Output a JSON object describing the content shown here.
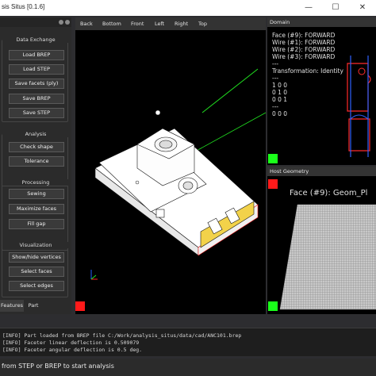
{
  "window": {
    "title": "sis Situs [0.1.6]",
    "minimize_glyph": "—",
    "maximize_glyph": "☐",
    "close_glyph": "✕"
  },
  "left_panel": {
    "groups": [
      {
        "title": "Data Exchange",
        "buttons": [
          "Load BREP",
          "Load STEP",
          "Save facets (ply)",
          "Save BREP",
          "Save STEP"
        ]
      },
      {
        "title": "Analysis",
        "buttons": [
          "Check shape",
          "Tolerance"
        ]
      },
      {
        "title": "Processing",
        "buttons": [
          "Sewing",
          "Maximize faces",
          "Fill gap"
        ]
      },
      {
        "title": "Visualization",
        "buttons": [
          "Show/hide vertices",
          "Select faces",
          "Select edges"
        ]
      }
    ],
    "tabs": [
      "Features",
      "Part"
    ]
  },
  "viewer": {
    "toolbar": [
      "Back",
      "Bottom",
      "Front",
      "Left",
      "Right",
      "Top"
    ],
    "axis_colors": {
      "x": "#ff2020",
      "y": "#20e020",
      "z": "#2060ff"
    }
  },
  "domain_pane": {
    "title": "Domain",
    "lines": [
      "Face (#9): FORWARD",
      "Wire (#1): FORWARD",
      "Wire (#2): FORWARD",
      "Wire (#3): FORWARD",
      "---",
      "Transformation: Identity",
      "---",
      "1 0 0",
      "0 1 0",
      "0 0 1",
      "---",
      "0 0 0"
    ]
  },
  "host_pane": {
    "title": "Host Geometry",
    "label": "Face (#9): Geom_Pl"
  },
  "console": {
    "lines": [
      "[INFO] Part loaded from BREP file C:/Work/analysis_situs/data/cad/ANC101.brep",
      "[INFO] Faceter linear deflection is 0.509079",
      "[INFO] Faceter angular deflection is 0.5 deg."
    ]
  },
  "status": {
    "text": "from STEP or BREP to start analysis"
  }
}
